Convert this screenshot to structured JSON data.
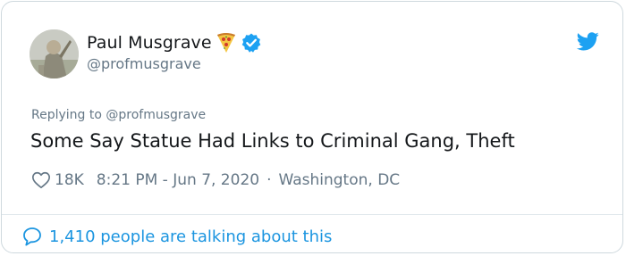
{
  "colors": {
    "link_blue": "#1b95e0",
    "secondary_gray": "#657786",
    "text": "#14171a",
    "border": "#cfd9de"
  },
  "author": {
    "display_name": "Paul Musgrave",
    "emoji_icon": "pizza-icon",
    "verified_icon": "verified-badge-icon",
    "handle": "@profmusgrave"
  },
  "brand_icon": "twitter-bird-icon",
  "tweet": {
    "replying_to": "Replying to @profmusgrave",
    "text": "Some Say Statue Had Links to Criminal Gang, Theft",
    "like_icon": "heart-icon",
    "likes": "18K",
    "timestamp": "8:21 PM - Jun 7, 2020",
    "separator": "·",
    "location": "Washington, DC"
  },
  "conversation": {
    "icon": "reply-bubble-icon",
    "label": "1,410 people are talking about this"
  }
}
